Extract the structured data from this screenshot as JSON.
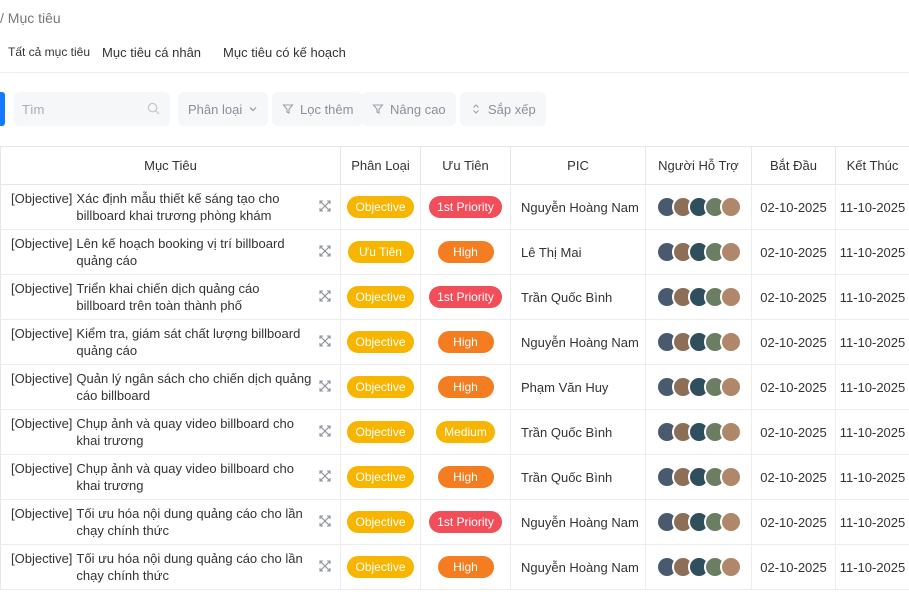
{
  "breadcrumb": "/ Mục tiêu",
  "tabs": [
    "Tất cả mục tiêu",
    "Mục tiêu cá nhân",
    "Mục tiêu có kế hoạch"
  ],
  "toolbar": {
    "search_placeholder": "Tìm",
    "classify_label": "Phân loại",
    "filter_label": "Lọc thêm",
    "advanced_label": "Nâng cao",
    "sort_label": "Sắp xếp"
  },
  "colors": {
    "accent": "#1677ff",
    "objective": "#f7b500",
    "priority1": "#f24e5a",
    "high": "#f47c21",
    "medium": "#f7b500"
  },
  "columns": [
    "Mục Tiêu",
    "Phân Loại",
    "Ưu Tiên",
    "PIC",
    "Người Hỗ Trợ",
    "Bắt Đầu",
    "Kết Thúc"
  ],
  "rows": [
    {
      "prefix": "[Objective]",
      "title": "Xác định mẫu thiết kế sáng tạo cho billboard khai trương phòng khám",
      "type": "Objective",
      "priority": "1st Priority",
      "pic": "Nguyễn Hoàng Nam",
      "start": "02-10-2025",
      "end": "11-10-2025"
    },
    {
      "prefix": "[Objective]",
      "title": "Lên kế hoạch booking vị trí billboard quảng cáo",
      "type": "Ưu Tiên",
      "priority": "High",
      "pic": "Lê Thị Mai",
      "start": "02-10-2025",
      "end": "11-10-2025"
    },
    {
      "prefix": "[Objective]",
      "title": "Triển khai chiến dịch quảng cáo billboard trên toàn thành phố",
      "type": "Objective",
      "priority": "1st Priority",
      "pic": "Trần Quốc Bình",
      "start": "02-10-2025",
      "end": "11-10-2025"
    },
    {
      "prefix": "[Objective]",
      "title": "Kiểm tra, giám sát chất lượng billboard quảng cáo",
      "type": "Objective",
      "priority": "High",
      "pic": "Nguyễn Hoàng Nam",
      "start": "02-10-2025",
      "end": "11-10-2025"
    },
    {
      "prefix": "[Objective]",
      "title": "Quản lý ngân sách cho chiến dịch quảng cáo billboard",
      "type": "Objective",
      "priority": "High",
      "pic": "Phạm Văn Huy",
      "start": "02-10-2025",
      "end": "11-10-2025"
    },
    {
      "prefix": "[Objective]",
      "title": "Chụp ảnh và quay video billboard cho khai trương",
      "type": "Objective",
      "priority": "Medium",
      "pic": "Trần Quốc Bình",
      "start": "02-10-2025",
      "end": "11-10-2025"
    },
    {
      "prefix": "[Objective]",
      "title": "Chụp ảnh và quay video billboard cho khai trương",
      "type": "Objective",
      "priority": "High",
      "pic": "Trần Quốc Bình",
      "start": "02-10-2025",
      "end": "11-10-2025"
    },
    {
      "prefix": "[Objective]",
      "title": "Tối ưu hóa nội dung quảng cáo cho lần chạy chính thức",
      "type": "Objective",
      "priority": "1st Priority",
      "pic": "Nguyễn Hoàng Nam",
      "start": "02-10-2025",
      "end": "11-10-2025"
    },
    {
      "prefix": "[Objective]",
      "title": "Tối ưu hóa nội dung quảng cáo cho lần chạy chính thức",
      "type": "Objective",
      "priority": "High",
      "pic": "Nguyễn Hoàng Nam",
      "start": "02-10-2025",
      "end": "11-10-2025"
    }
  ]
}
